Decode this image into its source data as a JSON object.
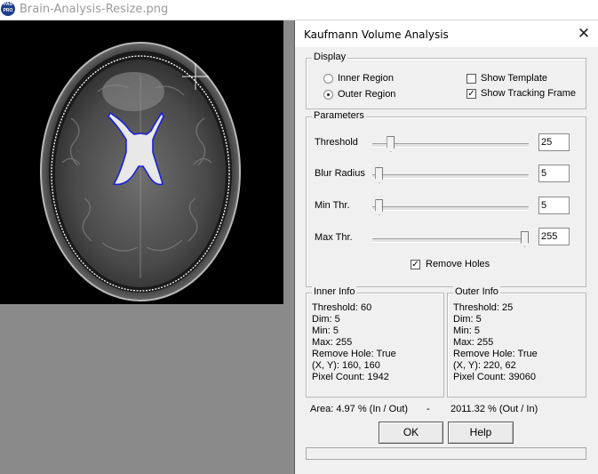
{
  "window": {
    "title": "Brain-Analysis-Resize.png",
    "icon_text": [
      "PAS",
      "PRO"
    ]
  },
  "dialog": {
    "title": "Kaufmann Volume Analysis",
    "close_glyph": "✕",
    "display": {
      "legend": "Display",
      "inner_region_label": "Inner Region",
      "outer_region_label": "Outer Region",
      "selected_region": "outer",
      "show_template_label": "Show Template",
      "show_template_checked": false,
      "show_tracking_frame_label": "Show Tracking Frame",
      "show_tracking_frame_checked": true
    },
    "parameters": {
      "legend": "Parameters",
      "threshold": {
        "label": "Threshold",
        "value": "25"
      },
      "blur_radius": {
        "label": "Blur Radius",
        "value": "5"
      },
      "min_thr": {
        "label": "Min Thr.",
        "value": "5"
      },
      "max_thr": {
        "label": "Max Thr.",
        "value": "255"
      },
      "slider_range": [
        0,
        255
      ],
      "remove_holes_label": "Remove Holes",
      "remove_holes_checked": true
    },
    "inner_info": {
      "legend": "Inner Info",
      "lines": [
        "Threshold: 60",
        "Dim: 5",
        "Min: 5",
        "Max: 255",
        "Remove Hole: True",
        "(X, Y): 160, 160",
        "Pixel Count: 1942"
      ]
    },
    "outer_info": {
      "legend": "Outer Info",
      "lines": [
        "Threshold: 25",
        "Dim: 5",
        "Min: 5",
        "Max: 255",
        "Remove Hole: True",
        "(X, Y): 220, 62",
        "Pixel Count: 39060"
      ]
    },
    "area": {
      "in_out": "Area: 4.97 % (In / Out)",
      "separator": "-",
      "out_in": "2011.32 % (Out / In)"
    },
    "buttons": {
      "ok": "OK",
      "help": "Help"
    },
    "progress": 0
  },
  "colors": {
    "inner_region_outline": "#1a22d8",
    "outer_region_outline": "#ffffff",
    "background_gray": "#8a8a8a"
  },
  "icons": {
    "app": "app-icon",
    "close": "close-icon",
    "crosshair": "crosshair-icon"
  }
}
